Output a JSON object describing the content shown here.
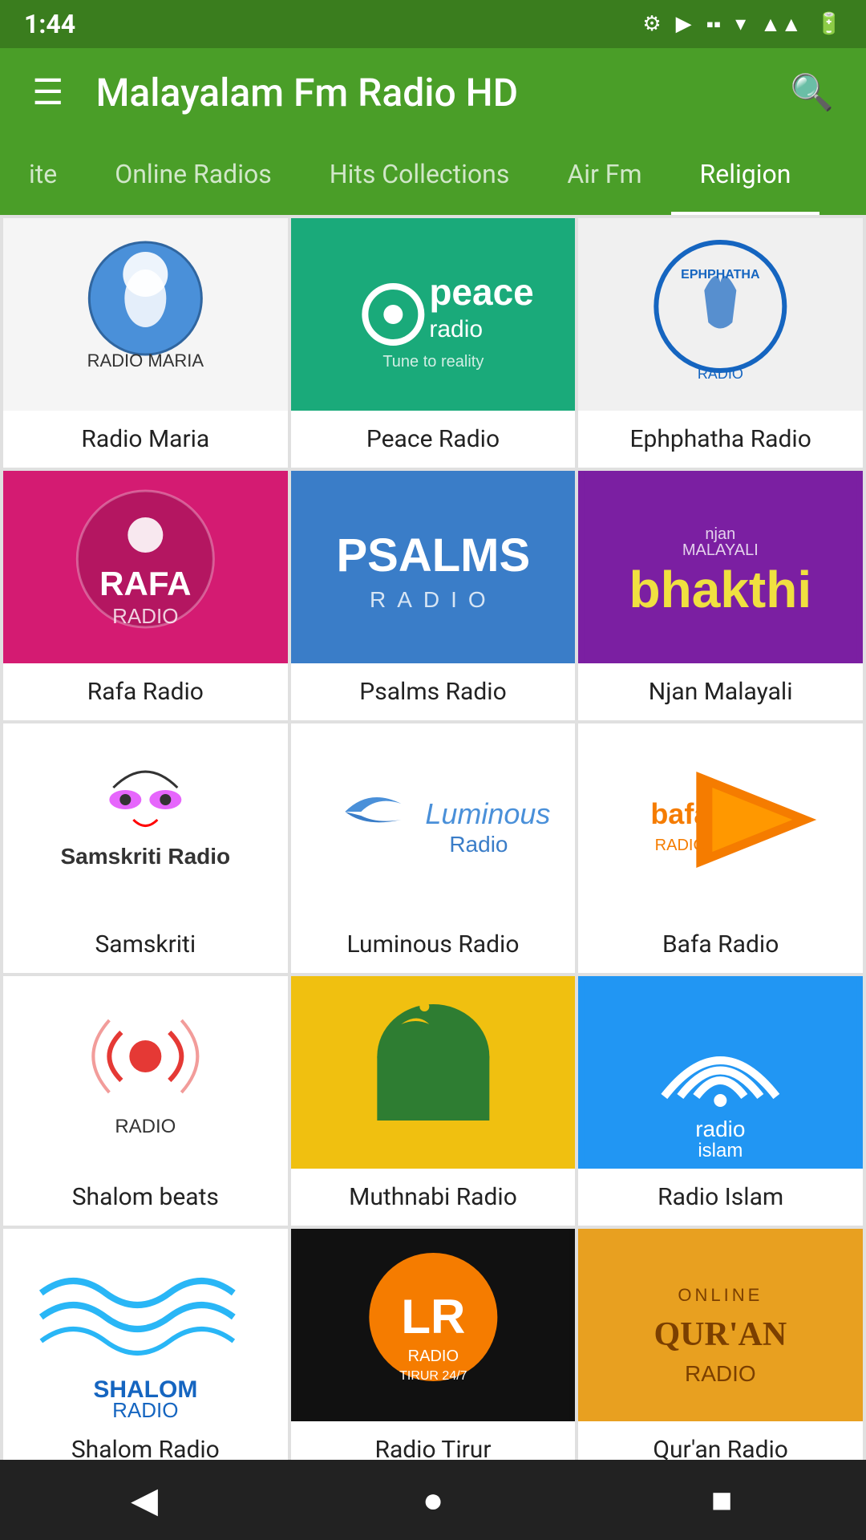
{
  "statusBar": {
    "time": "1:44",
    "icons": [
      "⚙",
      "▶",
      "▪",
      "▾",
      "▲",
      "▐▐"
    ]
  },
  "topBar": {
    "menuIcon": "☰",
    "title": "Malayalam Fm Radio HD",
    "searchIcon": "🔍"
  },
  "tabs": [
    {
      "id": "favourite",
      "label": "ite",
      "active": false
    },
    {
      "id": "online-radios",
      "label": "Online Radios",
      "active": false
    },
    {
      "id": "hits-collections",
      "label": "Hits Collections",
      "active": false
    },
    {
      "id": "air-fm",
      "label": "Air Fm",
      "active": false
    },
    {
      "id": "religion",
      "label": "Religion",
      "active": true
    }
  ],
  "cards": [
    {
      "id": "radio-maria",
      "label": "Radio Maria",
      "bgClass": "img-radio-maria"
    },
    {
      "id": "peace-radio",
      "label": "Peace Radio",
      "bgClass": "img-peace-radio"
    },
    {
      "id": "ephphatha-radio",
      "label": "Ephphatha Radio",
      "bgClass": "img-ephphatha"
    },
    {
      "id": "rafa-radio",
      "label": "Rafa Radio",
      "bgClass": "img-rafa"
    },
    {
      "id": "psalms-radio",
      "label": "Psalms Radio",
      "bgClass": "img-psalms"
    },
    {
      "id": "njan-malayali",
      "label": "Njan Malayali",
      "bgClass": "img-njan"
    },
    {
      "id": "samskriti",
      "label": "Samskriti",
      "bgClass": "img-samskriti"
    },
    {
      "id": "luminous-radio",
      "label": "Luminous Radio",
      "bgClass": "img-luminous"
    },
    {
      "id": "bafa-radio",
      "label": "Bafa Radio",
      "bgClass": "img-bafa"
    },
    {
      "id": "shalom-beats",
      "label": "Shalom beats",
      "bgClass": "img-shalom-beats"
    },
    {
      "id": "muthnabi-radio",
      "label": "Muthnabi Radio",
      "bgClass": "img-muthnabi"
    },
    {
      "id": "radio-islam",
      "label": "Radio Islam",
      "bgClass": "img-radio-islam"
    },
    {
      "id": "shalom-radio",
      "label": "Shalom Radio",
      "bgClass": "img-shalom-radio"
    },
    {
      "id": "radio-tirur",
      "label": "Radio Tirur",
      "bgClass": "img-radio-tirur"
    },
    {
      "id": "quran-radio",
      "label": "Qur'an Radio",
      "bgClass": "img-quran-radio"
    }
  ],
  "bottomNav": {
    "back": "◀",
    "home": "●",
    "recent": "■"
  }
}
